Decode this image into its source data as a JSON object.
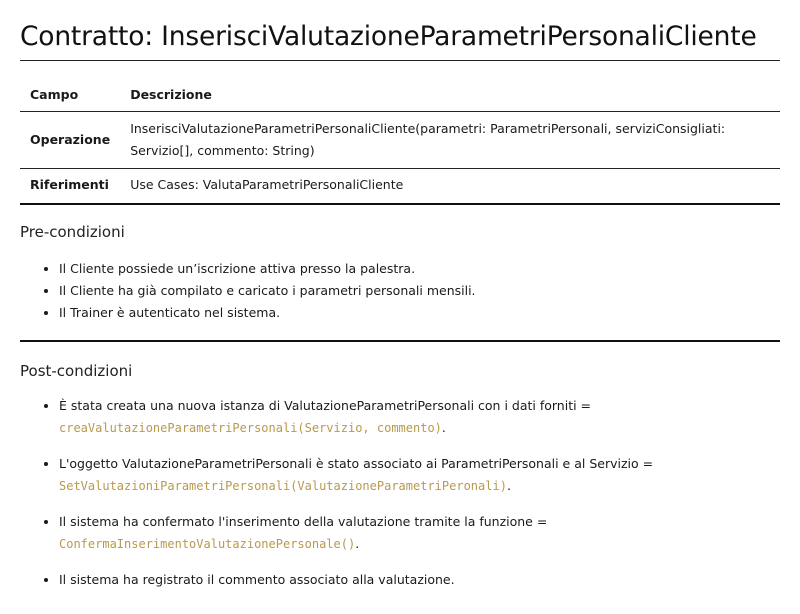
{
  "title": "Contratto: InserisciValutazioneParametriPersonaliCliente",
  "table": {
    "headers": [
      "Campo",
      "Descrizione"
    ],
    "rows": [
      {
        "campo": "Operazione",
        "descrizione": "InserisciValutazioneParametriPersonaliCliente(parametri: ParametriPersonali, serviziConsigliati: Servizio[], commento: String)"
      },
      {
        "campo": "Riferimenti",
        "descrizione": "Use Cases: ValutaParametriPersonaliCliente"
      }
    ]
  },
  "pre_conditions": {
    "heading": "Pre-condizioni",
    "items": [
      "Il Cliente possiede un’iscrizione attiva presso la palestra.",
      "Il Cliente ha già compilato e caricato i parametri personali mensili.",
      "Il Trainer è autenticato nel sistema."
    ]
  },
  "post_conditions": {
    "heading": "Post-condizioni",
    "items": [
      {
        "text": "È stata creata una nuova istanza di ValutazioneParametriPersonali con i dati forniti =",
        "code": "creaValutazioneParametriPersonali(Servizio, commento)",
        "suffix": "."
      },
      {
        "text": "L'oggetto ValutazioneParametriPersonali è stato associato ai ParametriPersonali e al Servizio =",
        "code": "SetValutazioniParametriPersonali(ValutazioneParametriPeronali)",
        "suffix": "."
      },
      {
        "text": "Il sistema ha confermato l'inserimento della valutazione tramite la funzione =",
        "code": "ConfermaInserimentoValutazionePersonale()",
        "suffix": "."
      },
      {
        "text": "Il sistema ha registrato il commento associato alla valutazione.",
        "code": "",
        "suffix": ""
      }
    ]
  },
  "colors": {
    "code": "#b8994d",
    "text": "#1a1a1a",
    "rule": "#111111"
  }
}
